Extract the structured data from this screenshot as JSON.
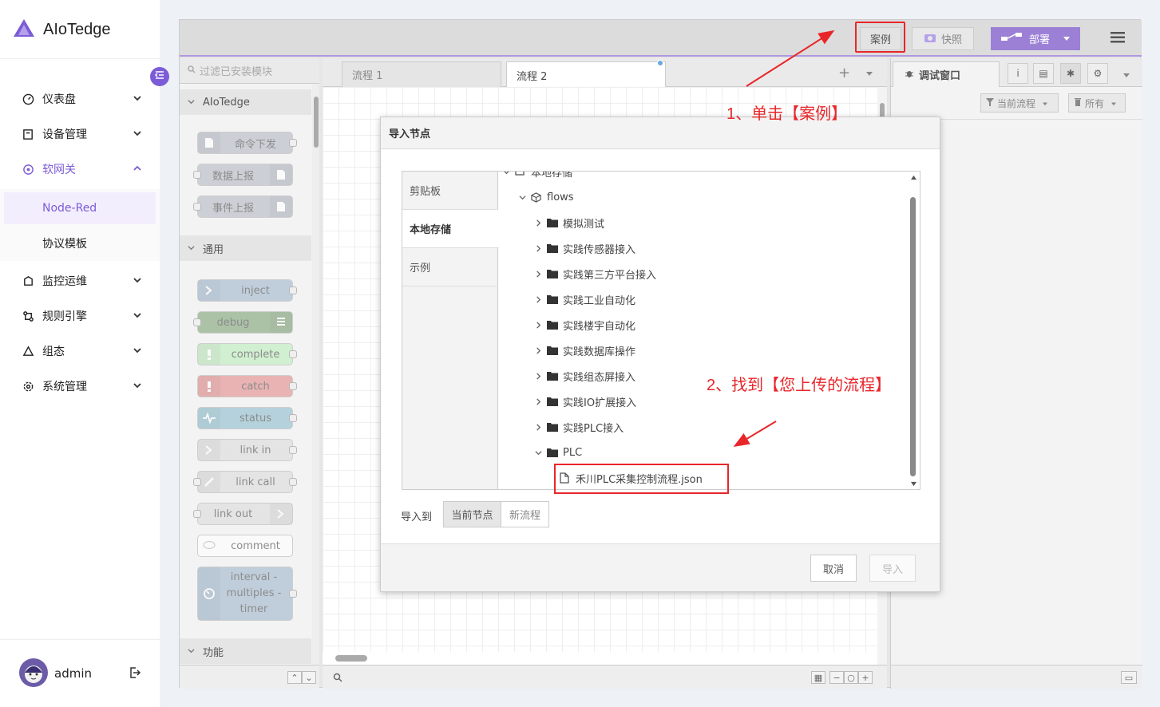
{
  "brand": {
    "name": "AIoTedge"
  },
  "sidebar": {
    "items": [
      {
        "label": "仪表盘"
      },
      {
        "label": "设备管理"
      },
      {
        "label": "软网关"
      },
      {
        "label": "监控运维"
      },
      {
        "label": "规则引擎"
      },
      {
        "label": "组态"
      },
      {
        "label": "系统管理"
      }
    ],
    "sub_items": [
      {
        "label": "Node-Red"
      },
      {
        "label": "协议模板"
      }
    ]
  },
  "user": {
    "name": "admin"
  },
  "nodered": {
    "header": {
      "example_label": "案例",
      "snapshot_label": "快照",
      "deploy_label": "部署"
    },
    "palette": {
      "filter_placeholder": "过滤已安装模块",
      "categories": [
        {
          "label": "AIoTedge",
          "nodes": [
            {
              "label": "命令下发"
            },
            {
              "label": "数据上报"
            },
            {
              "label": "事件上报"
            }
          ]
        },
        {
          "label": "通用",
          "nodes": [
            {
              "label": "inject"
            },
            {
              "label": "debug"
            },
            {
              "label": "complete"
            },
            {
              "label": "catch"
            },
            {
              "label": "status"
            },
            {
              "label": "link in"
            },
            {
              "label": "link call"
            },
            {
              "label": "link out"
            },
            {
              "label": "comment"
            },
            {
              "label": "interval - multiples - timer"
            }
          ]
        },
        {
          "label": "功能",
          "nodes": []
        }
      ]
    },
    "tabs": [
      {
        "label": "流程 1"
      },
      {
        "label": "流程 2"
      }
    ],
    "sidebar": {
      "tab_label": "调试窗口",
      "filter_current": "当前流程",
      "filter_all": "所有"
    }
  },
  "dialog": {
    "title": "导入节点",
    "tabs": [
      {
        "label": "剪贴板"
      },
      {
        "label": "本地存储"
      },
      {
        "label": "示例"
      }
    ],
    "tree": {
      "root": "本地存储",
      "flows_folder": "flows",
      "folders": [
        "模拟测试",
        "实践传感器接入",
        "实践第三方平台接入",
        "实践工业自动化",
        "实践楼宇自动化",
        "实践数据库操作",
        "实践组态屏接入",
        "实践IO扩展接入",
        "实践PLC接入",
        "PLC"
      ],
      "file": "禾川PLC采集控制流程.json"
    },
    "import_to_label": "导入到",
    "import_current": "当前节点",
    "import_new": "新流程",
    "cancel": "取消",
    "import": "导入"
  },
  "annotations": {
    "step1": "1、单击【案例】",
    "step2": "2、找到【您上传的流程】"
  },
  "colors": {
    "accent": "#7c5cd6",
    "annotation": "#e8262a",
    "deploy": "#9b80d6"
  }
}
